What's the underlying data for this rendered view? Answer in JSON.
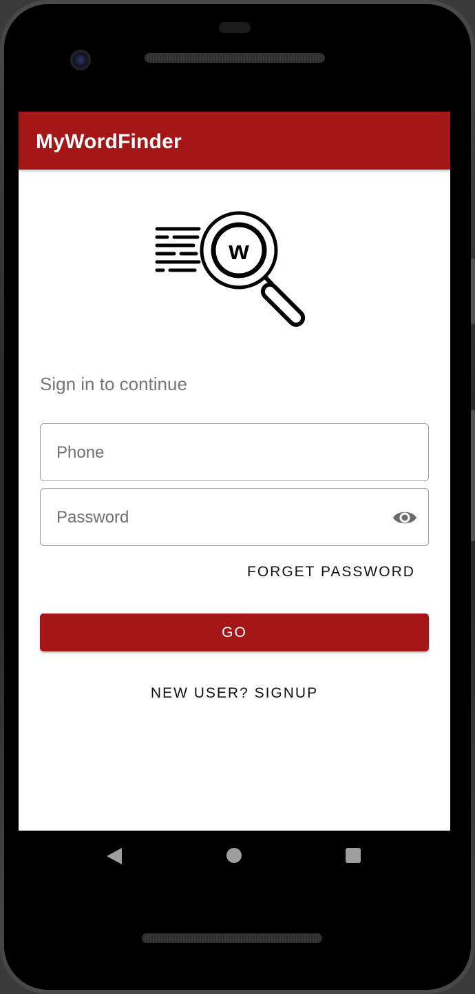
{
  "app": {
    "title": "MyWordFinder"
  },
  "logo": {
    "icon": "word-search-magnifier-icon",
    "letter": "w"
  },
  "login": {
    "subtitle": "Sign in to continue",
    "phone_placeholder": "Phone",
    "password_placeholder": "Password",
    "forget_label": "FORGET PASSWORD",
    "go_label": "GO",
    "signup_label": "NEW USER? SIGNUP"
  },
  "colors": {
    "brand": "#a51616",
    "text_muted": "#757575"
  },
  "system_nav": {
    "back_icon": "back-triangle-icon",
    "home_icon": "home-circle-icon",
    "recents_icon": "recents-square-icon"
  }
}
